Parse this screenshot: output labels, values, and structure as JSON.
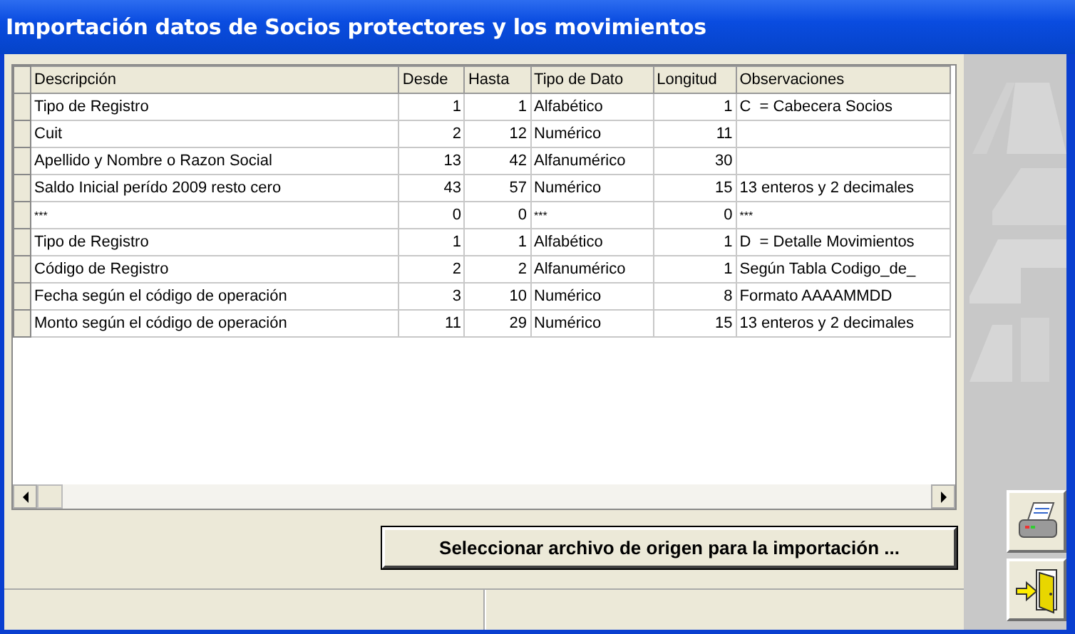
{
  "window": {
    "title": "Importación datos de Socios protectores y los movimientos"
  },
  "table": {
    "columns": [
      {
        "label": "Descripción"
      },
      {
        "label": "Desde"
      },
      {
        "label": "Hasta"
      },
      {
        "label": "Tipo de Dato"
      },
      {
        "label": "Longitud"
      },
      {
        "label": "Observaciones"
      }
    ],
    "rows": [
      {
        "cells": [
          "Tipo de Registro",
          "1",
          "1",
          "Alfabético",
          "1",
          "C  = Cabecera Socios"
        ]
      },
      {
        "cells": [
          "Cuit",
          "2",
          "12",
          "Numérico",
          "11"
        ]
      },
      {
        "cells": [
          "Apellido y Nombre o Razon Social",
          "13",
          "42",
          "Alfanumérico",
          "30"
        ]
      },
      {
        "cells": [
          "Saldo Inicial perído 2009 resto cero",
          "43",
          "57",
          "Numérico",
          "15",
          "13 enteros y 2 decimales"
        ]
      },
      {
        "cells": [
          "***",
          "0",
          "0",
          "***",
          "0",
          "***"
        ],
        "kind": "separator"
      },
      {
        "cells": [
          "Tipo de Registro",
          "1",
          "1",
          "Alfabético",
          "1",
          "D  = Detalle Movimientos"
        ]
      },
      {
        "cells": [
          "Código de Registro",
          "2",
          "2",
          "Alfanumérico",
          "1",
          "Según Tabla Codigo_de_"
        ]
      },
      {
        "cells": [
          "Fecha según el código de operación",
          "3",
          "10",
          "Numérico",
          "8",
          "Formato AAAAMMDD"
        ]
      },
      {
        "cells": [
          "Monto según el código de operación",
          "11",
          "29",
          "Numérico",
          "15",
          "13 enteros y 2 decimales"
        ]
      }
    ]
  },
  "buttons": [
    {
      "label": "Seleccionar archivo de origen para la importación ..."
    }
  ],
  "side_buttons": [
    {
      "kind": "print"
    },
    {
      "kind": "exit"
    }
  ]
}
